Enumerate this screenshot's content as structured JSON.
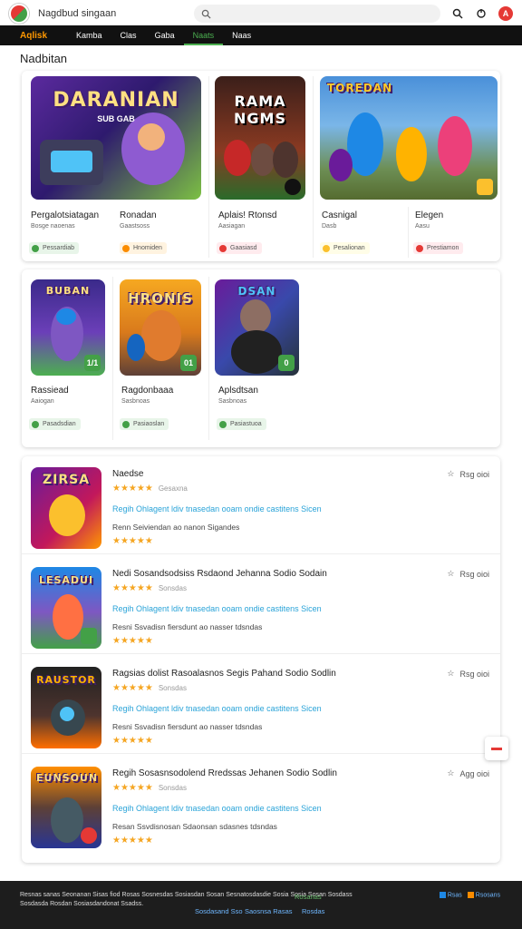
{
  "header": {
    "site_title": "Nagdbud singaan",
    "avatar_letter": "A"
  },
  "nav": {
    "brand": "Aqlisk",
    "items": [
      "Kamba",
      "Clas",
      "Gaba",
      "Naats",
      "Naas"
    ],
    "active_index": 3
  },
  "section_title": "Nadbitan",
  "top_cards": [
    {
      "art_title": "DARANIAN",
      "art_sub": "SUB GAB",
      "name": "Pergalotsiatagan",
      "sub": "Bosge naoenas",
      "chip": "Pessardiab"
    },
    {
      "art_title": "RAMA NGMS",
      "art_sub": "",
      "name": "Ronadan",
      "sub": "Gaastsoss",
      "chip": "Hnomiden"
    },
    {
      "art_title": "Aplais! Rtonsd",
      "art_sub": "",
      "name": "Aplais! Rtonsd",
      "sub": "Aasiagan",
      "chip": "Gaasiasd"
    },
    {
      "art_title": "TOREDAN",
      "art_sub": "",
      "name": "Casnigal",
      "sub": "Dasb",
      "chip": "Pesalionan"
    },
    {
      "art_title": "",
      "art_sub": "",
      "name": "Elegen",
      "sub": "Aasu",
      "chip": "Prestiamon"
    }
  ],
  "mid_cards": [
    {
      "art_title": "BUBAN",
      "badge": "1/1",
      "name": "Rassiead",
      "sub": "Aaiogan",
      "chip": "Pasadsdian"
    },
    {
      "art_title": "HRONIS",
      "badge": "01",
      "name": "Ragdonbaaa",
      "sub": "Sasbnoas",
      "chip": "Pasiaoslan"
    },
    {
      "art_title": "DSAN",
      "badge": "0",
      "name": "Aplsdtsan",
      "sub": "Sasbnoas",
      "chip": "Pasiastuoa"
    }
  ],
  "list_rows": [
    {
      "art_title": "ZIRSA",
      "title": "Naedse",
      "rating_meta": "Gesaxna",
      "link": "Regih Ohlagent ldiv tnasedan ooam ondie castitens Sicen",
      "desc": "Renn Seiviendan ao nanon Sigandes",
      "bookmark": "Rsg oioi"
    },
    {
      "art_title": "LESADUI",
      "title": "Nedi Sosandsodsiss Rsdaond Jehanna Sodio Sodain",
      "rating_meta": "Sonsdas",
      "link": "Regih Ohlagent ldiv tnasedan ooam ondie castitens Sicen",
      "desc": "Resni Ssvadisn fiersdunt ao nasser tdsndas",
      "bookmark": "Rsg oioi"
    },
    {
      "art_title": "RAUSTOR",
      "title": "Ragsias dolist Rasoalasnos Segis Pahand Sodio Sodlin",
      "rating_meta": "Sonsdas",
      "link": "Regih Ohlagent ldiv tnasedan ooam ondie castitens Sicen",
      "desc": "Resni Ssvadisn fiersdunt ao nasser tdsndas",
      "bookmark": "Rsg oioi"
    },
    {
      "art_title": "EUNSOUN",
      "title": "Regih Sosasnsodolend Rredssas Jehanen Sodio Sodlin",
      "rating_meta": "Sonsdas",
      "link": "Regih Ohlagent ldiv tnasedan ooam ondie castitens Sicen",
      "desc": "Resan Ssvdisnosan Sdaonsan sdasnes tdsndas",
      "bookmark": "Agg oioi"
    }
  ],
  "footer": {
    "line1": "Resnas sanas Seonanan Sisas fiod Rosas Sosnesdas Sosiasdan Sosan Sesnatosdasdie Sosia Sosia Sosan Sosdass",
    "line2": "Sosdasda Rosdan Sosiasdandonat Ssadss.",
    "green_text": "Rosanas",
    "badges": [
      "Rsas",
      "Rsosans"
    ],
    "links": [
      "Sosdasand Sso",
      "Saosnsa Rasas",
      "Rosdas"
    ]
  }
}
